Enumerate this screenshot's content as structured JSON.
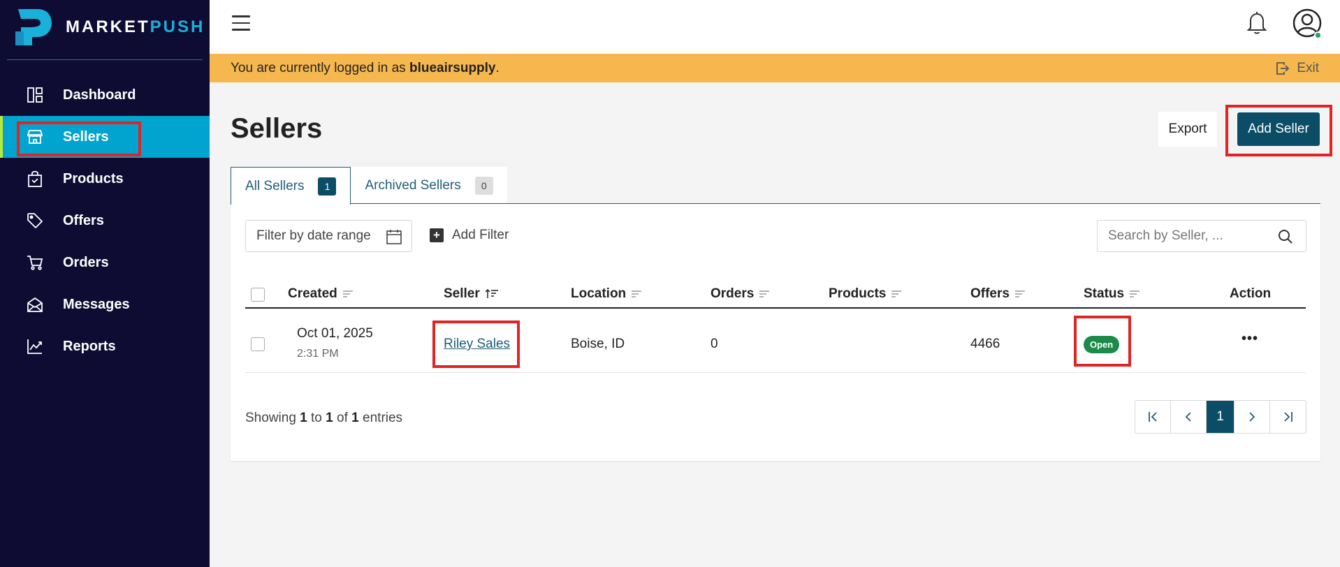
{
  "brand": {
    "name_a": "MARKET",
    "name_b": "PUSH",
    "accent": "#19b1d9"
  },
  "sidebar": {
    "items": [
      {
        "label": "Dashboard",
        "icon": "dashboard-icon"
      },
      {
        "label": "Sellers",
        "icon": "store-icon",
        "active": true
      },
      {
        "label": "Products",
        "icon": "bag-icon"
      },
      {
        "label": "Offers",
        "icon": "tag-icon"
      },
      {
        "label": "Orders",
        "icon": "cart-icon"
      },
      {
        "label": "Messages",
        "icon": "envelope-icon"
      },
      {
        "label": "Reports",
        "icon": "chart-line-icon"
      }
    ]
  },
  "banner": {
    "prefix": "You are currently logged in as ",
    "user": "blueairsupply",
    "suffix": ".",
    "exit_label": "Exit"
  },
  "page": {
    "title": "Sellers",
    "export_label": "Export",
    "add_label": "Add Seller"
  },
  "tabs": [
    {
      "label": "All Sellers",
      "count": "1"
    },
    {
      "label": "Archived Sellers",
      "count": "0"
    }
  ],
  "filters": {
    "date_placeholder": "Filter by date range",
    "add_filter_label": "Add Filter",
    "search_placeholder": "Search by Seller, ..."
  },
  "table": {
    "columns": [
      "Created",
      "Seller",
      "Location",
      "Orders",
      "Products",
      "Offers",
      "Status",
      "Action"
    ],
    "rows": [
      {
        "date": "Oct 01, 2025",
        "time": "2:31 PM",
        "seller": "Riley Sales",
        "location": "Boise, ID",
        "orders": "0",
        "products": "",
        "offers": "4466",
        "status": "Open"
      }
    ]
  },
  "footer": {
    "showing": "Showing",
    "from": "1",
    "to_word": "to",
    "to": "1",
    "of_word": "of",
    "total": "1",
    "entries": "entries"
  },
  "pagination": {
    "current": "1"
  },
  "colors": {
    "sidebar_bg": "#0e0c33",
    "active_nav": "#00a4cf",
    "banner": "#f6b84e",
    "primary": "#0b4c66",
    "status_open": "#1c8a4b"
  }
}
